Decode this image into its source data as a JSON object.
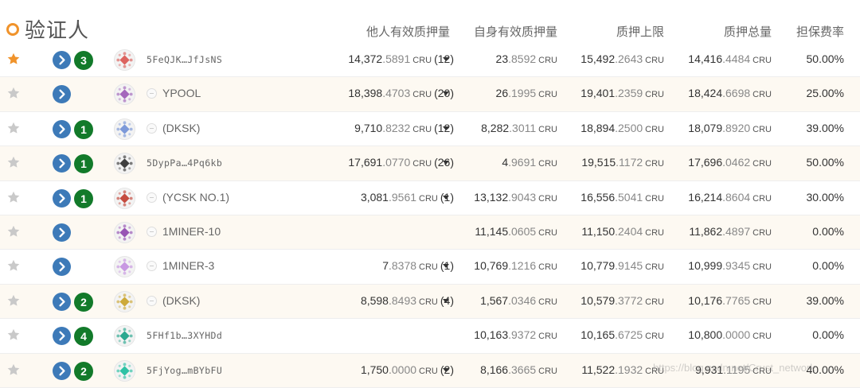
{
  "header": {
    "title": "验证人",
    "columns": [
      "他人有效质押量",
      "自身有效质押量",
      "质押上限",
      "质押总量",
      "担保费率"
    ]
  },
  "unit": "CRU",
  "colors": {
    "star_active": "#f0932b",
    "star_inactive": "#c9c9c9",
    "go_button": "#3d7ab8",
    "count_badge": "#127a2a",
    "title_dot": "#f0932b"
  },
  "rows": [
    {
      "starred": true,
      "count": "3",
      "name": "5FeQJK…JfJsNS",
      "name_type": "addr",
      "avatar_color": "#d9534f",
      "others_int": "14,372",
      "others_dec": ".5891",
      "others_cnt": "(12)",
      "has_caret": true,
      "own_int": "23",
      "own_dec": ".8592",
      "cap_int": "15,492",
      "cap_dec": ".2643",
      "total_int": "14,416",
      "total_dec": ".4484",
      "rate": "50.00%"
    },
    {
      "starred": false,
      "count": "",
      "name": "YPOOL",
      "name_type": "ident",
      "avatar_color": "#9b59b6",
      "others_int": "18,398",
      "others_dec": ".4703",
      "others_cnt": "(20)",
      "has_caret": true,
      "own_int": "26",
      "own_dec": ".1995",
      "cap_int": "19,401",
      "cap_dec": ".2359",
      "total_int": "18,424",
      "total_dec": ".6698",
      "rate": "25.00%"
    },
    {
      "starred": false,
      "count": "1",
      "name": "(DKSK)",
      "name_type": "ident",
      "avatar_color": "#6f8fd6",
      "others_int": "9,710",
      "others_dec": ".8232",
      "others_cnt": "(12)",
      "has_caret": true,
      "own_int": "8,282",
      "own_dec": ".3011",
      "cap_int": "18,894",
      "cap_dec": ".2500",
      "total_int": "18,079",
      "total_dec": ".8920",
      "rate": "39.00%"
    },
    {
      "starred": false,
      "count": "1",
      "name": "5DypPa…4Pq6kb",
      "name_type": "addr",
      "avatar_color": "#2c2c2c",
      "others_int": "17,691",
      "others_dec": ".0770",
      "others_cnt": "(26)",
      "has_caret": true,
      "own_int": "4",
      "own_dec": ".9691",
      "cap_int": "19,515",
      "cap_dec": ".1172",
      "total_int": "17,696",
      "total_dec": ".0462",
      "rate": "50.00%"
    },
    {
      "starred": false,
      "count": "1",
      "name": "(YCSK NO.1)",
      "name_type": "ident",
      "avatar_color": "#c0392b",
      "others_int": "3,081",
      "others_dec": ".9561",
      "others_cnt": "(1)",
      "has_caret": true,
      "own_int": "13,132",
      "own_dec": ".9043",
      "cap_int": "16,556",
      "cap_dec": ".5041",
      "total_int": "16,214",
      "total_dec": ".8604",
      "rate": "30.00%"
    },
    {
      "starred": false,
      "count": "",
      "name": "1MINER-10",
      "name_type": "ident",
      "avatar_color": "#8e44ad",
      "others_int": "",
      "others_dec": "",
      "others_cnt": "",
      "has_caret": false,
      "own_int": "11,145",
      "own_dec": ".0605",
      "cap_int": "11,150",
      "cap_dec": ".2404",
      "total_int": "11,862",
      "total_dec": ".4897",
      "rate": "0.00%"
    },
    {
      "starred": false,
      "count": "",
      "name": "1MINER-3",
      "name_type": "ident",
      "avatar_color": "#c38ee0",
      "others_int": "7",
      "others_dec": ".8378",
      "others_cnt": "(1)",
      "has_caret": true,
      "own_int": "10,769",
      "own_dec": ".1216",
      "cap_int": "10,779",
      "cap_dec": ".9145",
      "total_int": "10,999",
      "total_dec": ".9345",
      "rate": "0.00%"
    },
    {
      "starred": false,
      "count": "2",
      "name": "(DKSK)",
      "name_type": "ident",
      "avatar_color": "#c9a227",
      "others_int": "8,598",
      "others_dec": ".8493",
      "others_cnt": "(4)",
      "has_caret": true,
      "own_int": "1,567",
      "own_dec": ".0346",
      "cap_int": "10,579",
      "cap_dec": ".3772",
      "total_int": "10,176",
      "total_dec": ".7765",
      "rate": "39.00%"
    },
    {
      "starred": false,
      "count": "4",
      "name": "5FHf1b…3XYHDd",
      "name_type": "addr",
      "avatar_color": "#16a085",
      "others_int": "",
      "others_dec": "",
      "others_cnt": "",
      "has_caret": false,
      "own_int": "10,163",
      "own_dec": ".9372",
      "cap_int": "10,165",
      "cap_dec": ".6725",
      "total_int": "10,800",
      "total_dec": ".0000",
      "rate": "0.00%"
    },
    {
      "starred": false,
      "count": "2",
      "name": "5FjYog…mBYbFU",
      "name_type": "addr",
      "avatar_color": "#1abc9c",
      "others_int": "1,750",
      "others_dec": ".0000",
      "others_cnt": "(2)",
      "has_caret": true,
      "own_int": "8,166",
      "own_dec": ".3665",
      "cap_int": "11,522",
      "cap_dec": ".1932",
      "total_int": "9,931",
      "total_dec": ".1195",
      "rate": "40.00%"
    }
  ],
  "watermark": "https://blog.csdn.net/Crust_network"
}
